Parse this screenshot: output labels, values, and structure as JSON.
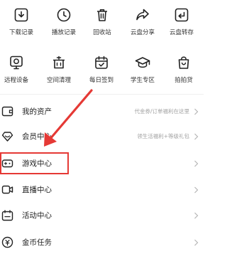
{
  "quick_actions_row1": [
    {
      "icon": "download-record-icon",
      "label": "下载记录"
    },
    {
      "icon": "clock-icon",
      "label": "播放记录"
    },
    {
      "icon": "trash-icon",
      "label": "回收站"
    },
    {
      "icon": "share-icon",
      "label": "云盘分享"
    },
    {
      "icon": "transfer-icon",
      "label": "云盘转存"
    }
  ],
  "quick_actions_row2": [
    {
      "icon": "camera-device-icon",
      "label": "远程设备"
    },
    {
      "icon": "clean-pot-icon",
      "label": "空间清理"
    },
    {
      "icon": "calendar-icon",
      "label": "每日签到"
    },
    {
      "icon": "graduation-cap-icon",
      "label": "学生专区"
    },
    {
      "icon": "shopping-bag-icon",
      "label": "拍拍贷"
    }
  ],
  "menu": [
    {
      "icon": "wallet-icon",
      "title": "我的资产",
      "hint": "代金券/订单福利在这里"
    },
    {
      "icon": "diamond-icon",
      "title": "会员中心",
      "hint": "领生活福利+等级礼包"
    },
    {
      "icon": "gamepad-icon",
      "title": "游戏中心",
      "hint": ""
    },
    {
      "icon": "live-video-icon",
      "title": "直播中心",
      "hint": ""
    },
    {
      "icon": "activity-calendar-icon",
      "title": "活动中心",
      "hint": ""
    },
    {
      "icon": "coin-icon",
      "title": "金币任务",
      "hint": ""
    }
  ],
  "colors": {
    "annotation": "#e53935",
    "text": "#222222",
    "hint": "#a3a3a3"
  }
}
